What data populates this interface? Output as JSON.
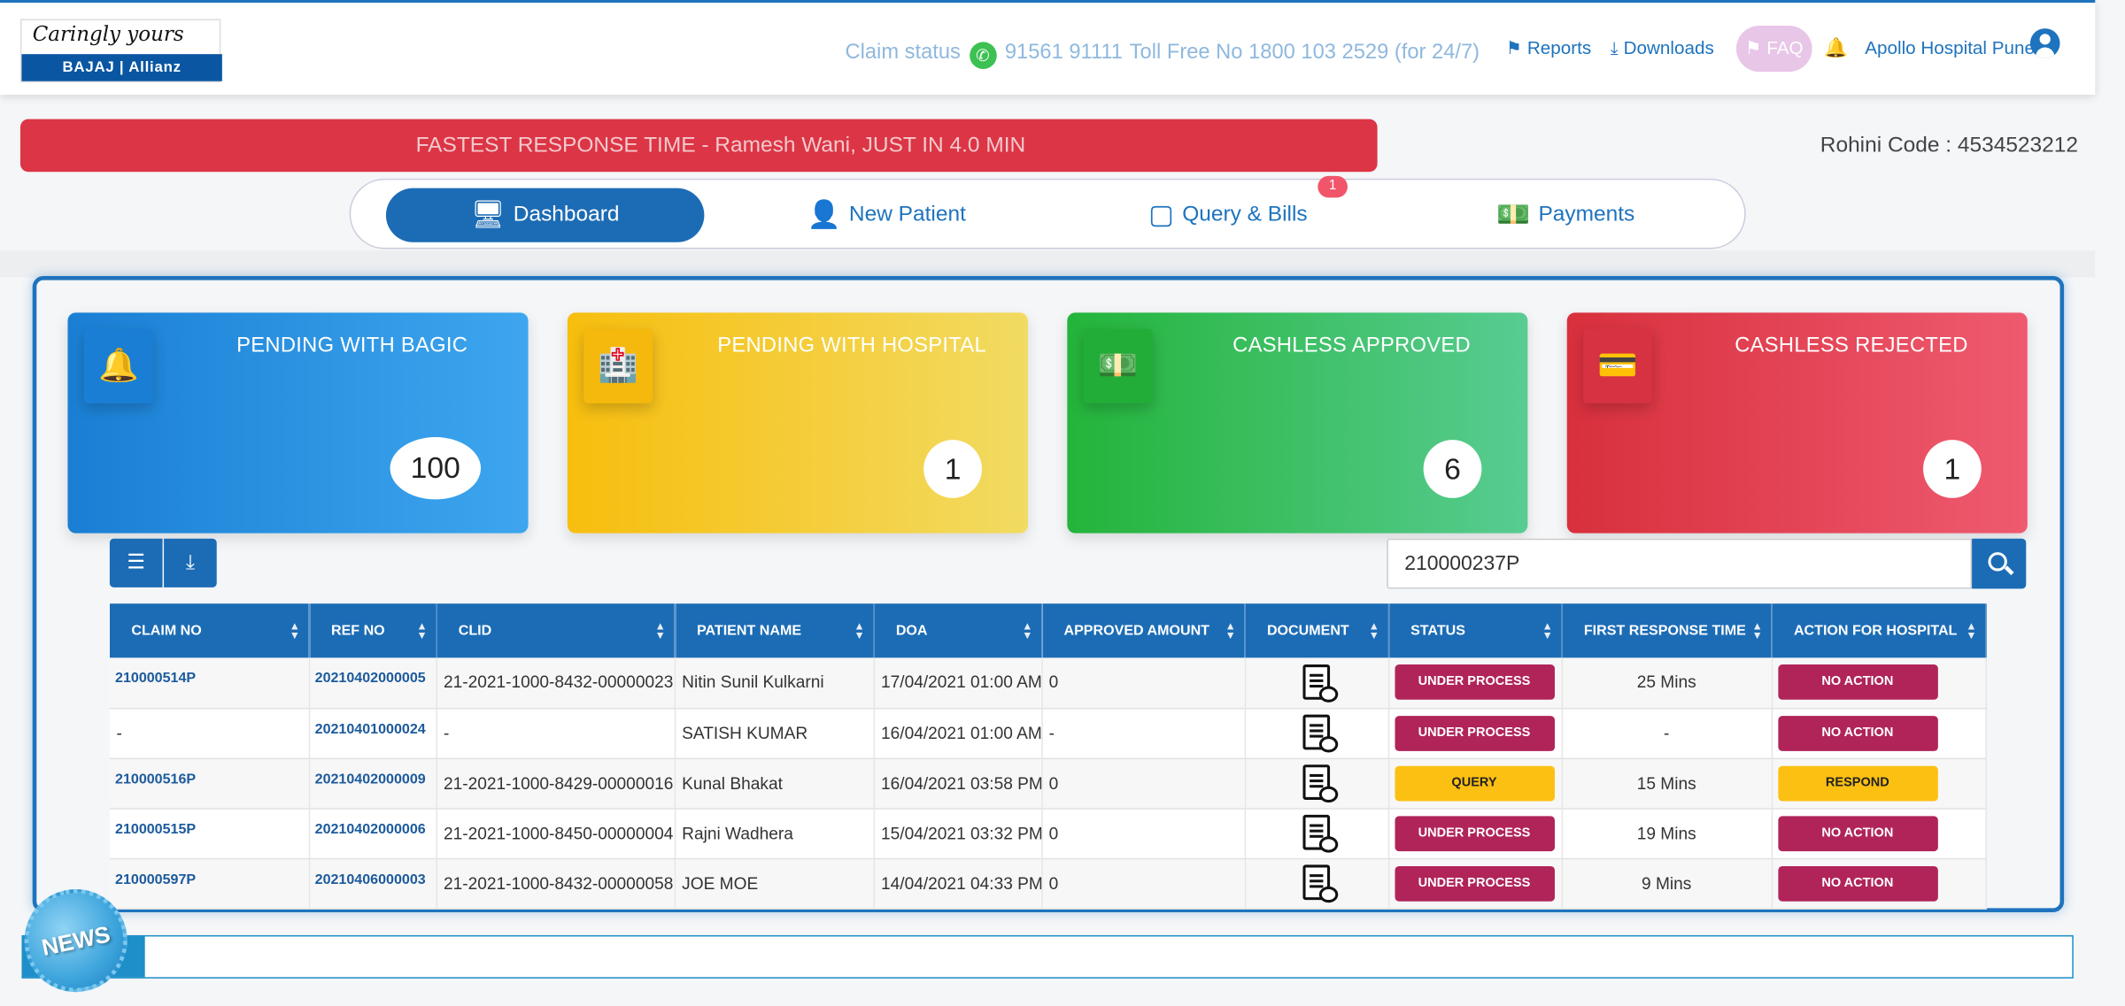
{
  "header": {
    "logo_tagline": "Caringly yours",
    "logo_brand": "BAJAJ | Allianz",
    "claim_status_label": "Claim status",
    "claim_status_phone": "91561 91111",
    "toll_free": "Toll Free No 1800 103 2529 (for 24/7)",
    "reports": "Reports",
    "downloads": "Downloads",
    "faq": "FAQ",
    "user": "Apollo Hospital Pune",
    "whatsapp_icon": "✆"
  },
  "banner": {
    "text": "FASTEST RESPONSE TIME - Ramesh Wani, JUST IN 4.0 MIN"
  },
  "rohini": "Rohini Code : 4534523212",
  "tabs": [
    {
      "label": "Dashboard",
      "active": true
    },
    {
      "label": "New Patient"
    },
    {
      "label": "Query & Bills",
      "badge": "1"
    },
    {
      "label": "Payments"
    }
  ],
  "cards": [
    {
      "title": "PENDING WITH BAGIC",
      "value": "100",
      "color": "#1a7fd4",
      "icon": "bell-icon"
    },
    {
      "title": "PENDING WITH HOSPITAL",
      "value": "1",
      "color": "#f5b80c",
      "icon": "hospital-icon"
    },
    {
      "title": "CASHLESS APPROVED",
      "value": "6",
      "color": "#22ad38",
      "icon": "money-bill-icon"
    },
    {
      "title": "CASHLESS REJECTED",
      "value": "1",
      "color": "#d63242",
      "icon": "credit-card-icon"
    }
  ],
  "search": {
    "value": "210000237P"
  },
  "table": {
    "columns": [
      "CLAIM NO",
      "REF NO",
      "CLID",
      "PATIENT NAME",
      "DOA",
      "APPROVED AMOUNT",
      "DOCUMENT",
      "STATUS",
      "FIRST RESPONSE TIME",
      "ACTION FOR HOSPITAL"
    ],
    "rows": [
      {
        "claim_no": "210000514P",
        "ref_no": "20210402000005",
        "clid": "21-2021-1000-8432-00000023",
        "patient": "Nitin Sunil Kulkarni",
        "doa": "17/04/2021 01:00 AM",
        "amount": "0",
        "status": "UNDER PROCESS",
        "frt": "25 Mins",
        "action": "NO ACTION"
      },
      {
        "claim_no": "-",
        "ref_no": "20210401000024",
        "clid": "-",
        "patient": "SATISH KUMAR",
        "doa": "16/04/2021 01:00 AM",
        "amount": "-",
        "status": "UNDER PROCESS",
        "frt": "-",
        "action": "NO ACTION"
      },
      {
        "claim_no": "210000516P",
        "ref_no": "20210402000009",
        "clid": "21-2021-1000-8429-00000016",
        "patient": "Kunal Bhakat",
        "doa": "16/04/2021 03:58 PM",
        "amount": "0",
        "status": "QUERY",
        "frt": "15 Mins",
        "action": "RESPOND"
      },
      {
        "claim_no": "210000515P",
        "ref_no": "20210402000006",
        "clid": "21-2021-1000-8450-00000004",
        "patient": "Rajni Wadhera",
        "doa": "15/04/2021 03:32 PM",
        "amount": "0",
        "status": "UNDER PROCESS",
        "frt": "19 Mins",
        "action": "NO ACTION"
      },
      {
        "claim_no": "210000597P",
        "ref_no": "20210406000003",
        "clid": "21-2021-1000-8432-00000058",
        "patient": "JOE MOE",
        "doa": "14/04/2021 04:33 PM",
        "amount": "0",
        "status": "UNDER PROCESS",
        "frt": "9 Mins",
        "action": "NO ACTION"
      }
    ]
  },
  "news": {
    "label": "NEWS"
  },
  "colors": {
    "primary": "#1c6cb5",
    "danger": "#dc3545",
    "under_process": "#b0245a",
    "query": "#fcc012"
  }
}
